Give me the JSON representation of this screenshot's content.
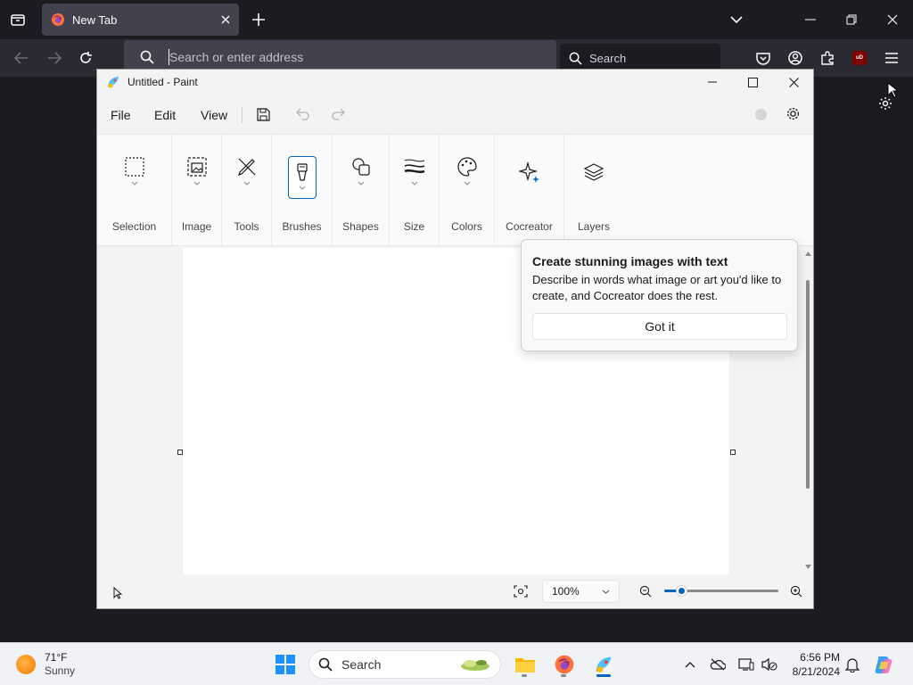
{
  "browser": {
    "tab_title": "New Tab",
    "url_placeholder": "Search or enter address",
    "search_placeholder": "Search",
    "ublock_badge": "uD"
  },
  "paint": {
    "title": "Untitled - Paint",
    "menu": [
      "File",
      "Edit",
      "View"
    ],
    "ribbon": [
      "Selection",
      "Image",
      "Tools",
      "Brushes",
      "Shapes",
      "Size",
      "Colors",
      "Cocreator",
      "Layers"
    ],
    "zoom": "100%"
  },
  "popup": {
    "title": "Create stunning images with text",
    "body": "Describe in words what image or art you'd like to create, and Cocreator does the rest.",
    "button": "Got it"
  },
  "taskbar": {
    "weather_temp": "71°F",
    "weather_cond": "Sunny",
    "search_placeholder": "Search",
    "time": "6:56 PM",
    "date": "8/21/2024"
  },
  "colors": {
    "firefox_dark": "#1c1b22",
    "firefox_toolbar": "#2b2a33",
    "accent": "#0067c0"
  }
}
